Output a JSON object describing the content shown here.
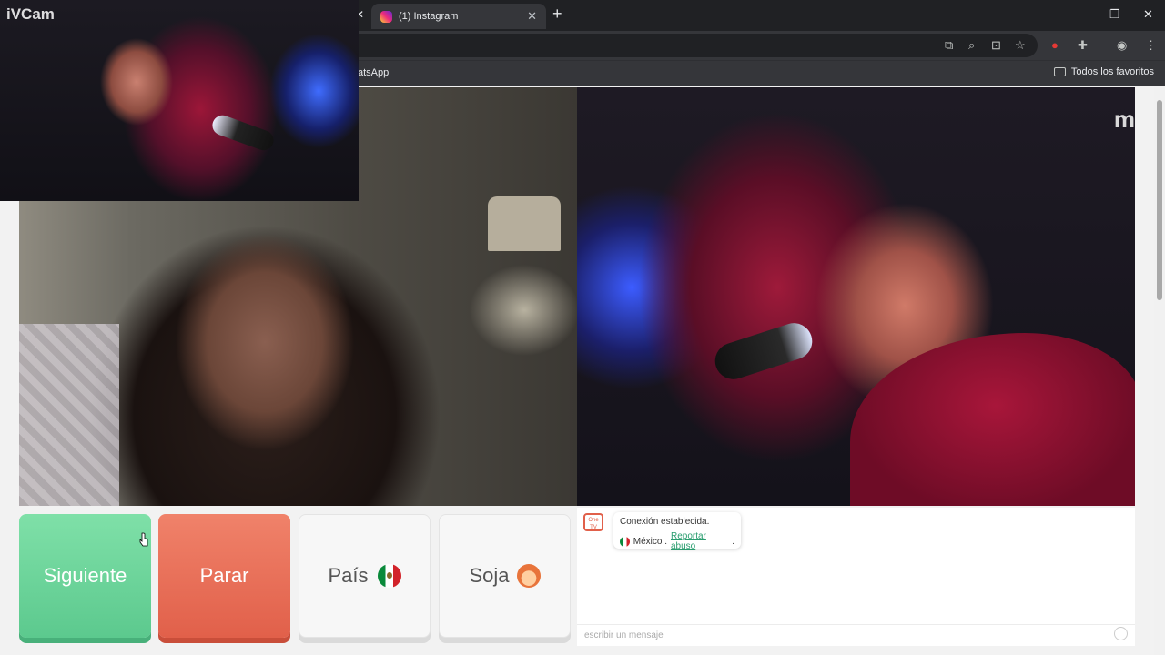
{
  "browser": {
    "tabs": [
      {
        "title": "(1) Instagram"
      }
    ],
    "bookmarks": {
      "partial_item": "atsApp",
      "all_favorites": "Todos los favoritos"
    }
  },
  "ivcam": {
    "title": "iVCam"
  },
  "controls": {
    "next_label": "Siguiente",
    "stop_label": "Parar",
    "country_label": "País",
    "gender_label": "Soja"
  },
  "chat": {
    "logo_text": "One TV",
    "connection_message": "Conexión establecida.",
    "country": "México",
    "report_link": "Reportar abuso",
    "input_placeholder": "escribir un mensaje"
  },
  "video": {
    "watermark": "m"
  },
  "colors": {
    "next": "#6dd49b",
    "stop": "#e8705a",
    "link": "#2a9d6f"
  }
}
